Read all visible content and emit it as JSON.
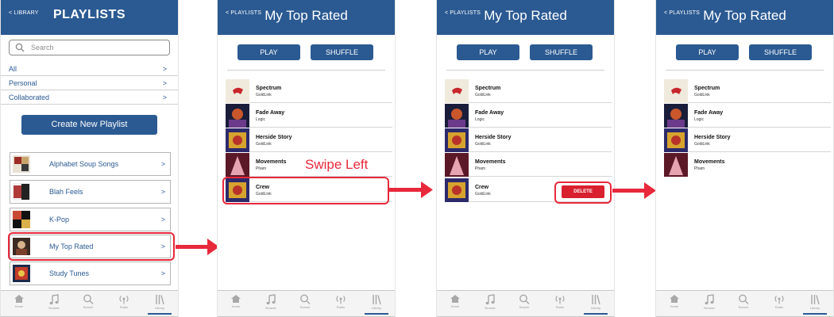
{
  "screen1": {
    "back": "< LIBRARY",
    "title": "PLAYLISTS",
    "search_placeholder": "Search",
    "filters": [
      {
        "label": "All",
        "chevron": ">"
      },
      {
        "label": "Personal",
        "chevron": ">"
      },
      {
        "label": "Collaborated",
        "chevron": ">"
      }
    ],
    "create_label": "Create New Playlist",
    "playlists": [
      {
        "name": "Alphabet Soup Songs",
        "chevron": ">"
      },
      {
        "name": "Blah Feels",
        "chevron": ">"
      },
      {
        "name": "K-Pop",
        "chevron": ">"
      },
      {
        "name": "My Top Rated",
        "chevron": ">"
      },
      {
        "name": "Study Tunes",
        "chevron": ">"
      }
    ]
  },
  "playlist_screen": {
    "back": "< PLAYLISTS",
    "title": "My Top Rated",
    "play_label": "PLAY",
    "shuffle_label": "SHUFFLE"
  },
  "songs": [
    {
      "title": "Spectrum",
      "artist": "GoldLink"
    },
    {
      "title": "Fade Away",
      "artist": "Logic"
    },
    {
      "title": "Herside Story",
      "artist": "GoldLink"
    },
    {
      "title": "Movements",
      "artist": "Pham"
    },
    {
      "title": "Crew",
      "artist": "GoldLink"
    }
  ],
  "annotation": "Swipe Left",
  "delete_label": "DELETE",
  "tabs": [
    {
      "label": "Home",
      "icon": "home-icon"
    },
    {
      "label": "Browse",
      "icon": "music-note-icon"
    },
    {
      "label": "Search",
      "icon": "search-icon"
    },
    {
      "label": "Radio",
      "icon": "radio-icon"
    },
    {
      "label": "Library",
      "icon": "library-icon"
    }
  ],
  "colors": {
    "brand_blue": "#2b5a92",
    "highlight_red": "#e8283b",
    "delete_red": "#d8202e"
  }
}
